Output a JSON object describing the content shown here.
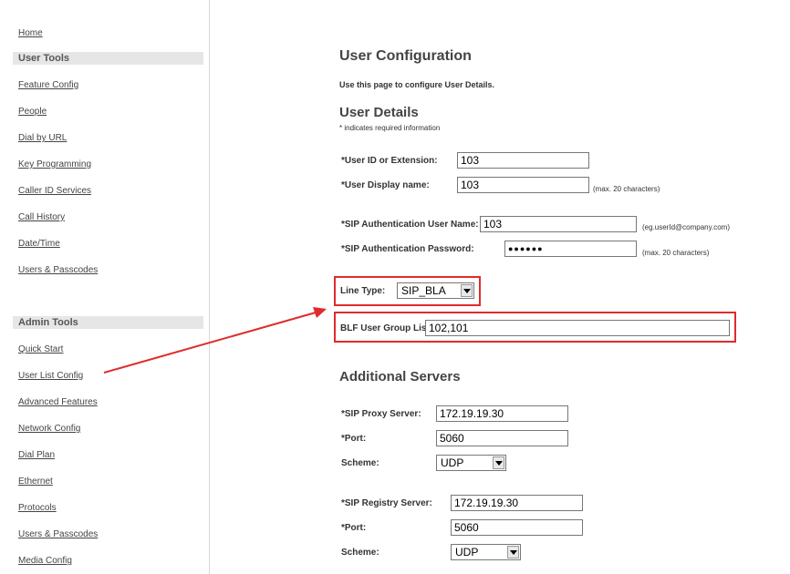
{
  "sidebar": {
    "home": "Home",
    "user_tools_heading": "User Tools",
    "user_tools": [
      "Feature Config",
      "People",
      "Dial by URL",
      "Key Programming",
      "Caller ID Services",
      "Call History",
      "Date/Time",
      "Users & Passcodes"
    ],
    "admin_tools_heading": "Admin Tools",
    "admin_tools": [
      "Quick Start",
      "User List Config",
      "Advanced Features",
      "Network Config",
      "Dial Plan",
      "Ethernet",
      "Protocols",
      "Users & Passcodes",
      "Media Config"
    ]
  },
  "main": {
    "title": "User Configuration",
    "description": "Use this page to configure User Details.",
    "user_details": {
      "heading": "User Details",
      "required_note": "* indicates required information",
      "user_id_label": "*User ID or Extension:",
      "user_id_value": "103",
      "display_name_label": "*User Display name:",
      "display_name_value": "103",
      "display_name_hint": "(max. 20 characters)",
      "sip_auth_user_label": "*SIP Authentication User Name:",
      "sip_auth_user_value": "103",
      "sip_auth_user_hint": "(eg.userId@company.com)",
      "sip_auth_pass_label": "*SIP Authentication Password:",
      "sip_auth_pass_value": "●●●●●●",
      "sip_auth_pass_hint": "(max. 20 characters)",
      "line_type_label": "Line Type:",
      "line_type_value": "SIP_BLA",
      "blf_label": "BLF User Group List:",
      "blf_value": "102,101"
    },
    "additional_servers": {
      "heading": "Additional Servers",
      "proxy_label": "*SIP Proxy Server:",
      "proxy_value": "172.19.19.30",
      "proxy_port_label": "*Port:",
      "proxy_port_value": "5060",
      "proxy_scheme_label": "Scheme:",
      "proxy_scheme_value": "UDP",
      "registry_label": "*SIP Registry Server:",
      "registry_value": "172.19.19.30",
      "registry_port_label": "*Port:",
      "registry_port_value": "5060",
      "registry_scheme_label": "Scheme:",
      "registry_scheme_value": "UDP"
    }
  },
  "annotation": {
    "color": "#e02b2b"
  }
}
